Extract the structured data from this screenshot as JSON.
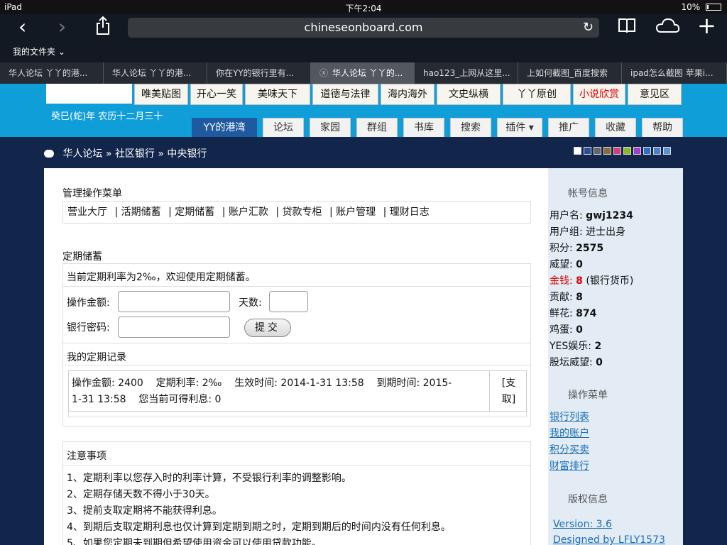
{
  "status_bar": {
    "device": "iPad",
    "time": "下午2:04",
    "battery": "10%"
  },
  "browser": {
    "url": "chineseonboard.com",
    "bookmark_folder": "我的文件夹",
    "tabs": [
      {
        "label": "华人论坛 丫丫的港..."
      },
      {
        "label": "华人论坛 丫丫的港..."
      },
      {
        "label": "你在YY的银行里有..."
      },
      {
        "label": "华人论坛 丫丫的..."
      },
      {
        "label": "hao123_上网从这里..."
      },
      {
        "label": "上如何截图_百度搜索"
      },
      {
        "label": "ipad怎么截图 苹果i..."
      }
    ]
  },
  "header": {
    "date": "癸巳(蛇)年 农历十二月三十",
    "categories": [
      {
        "label": "唯美贴图"
      },
      {
        "label": "开心一笑"
      },
      {
        "label": "美味天下"
      },
      {
        "label": "道德与法律"
      },
      {
        "label": "海内海外"
      },
      {
        "label": "文史纵横"
      },
      {
        "label": "丫丫原创"
      },
      {
        "label": "小说欣赏"
      },
      {
        "label": "意见区"
      }
    ],
    "nav": [
      {
        "label": "YY的港湾"
      },
      {
        "label": "论坛"
      },
      {
        "label": "家园"
      },
      {
        "label": "群组"
      },
      {
        "label": "书库"
      },
      {
        "label": "搜索"
      },
      {
        "label": "插件 ▾"
      },
      {
        "label": "推广"
      },
      {
        "label": "收藏"
      },
      {
        "label": "帮助"
      }
    ]
  },
  "breadcrumb": {
    "home": "华人论坛",
    "sep": "»",
    "level1": "社区银行",
    "level2": "中央银行"
  },
  "theme_swatches": [
    "#ffffff",
    "#2a4f94",
    "#666666",
    "#8a6b3a",
    "#d04080",
    "#8ab820",
    "#a040c0",
    "#3070c0",
    "#4a80c8",
    "#5a90d0"
  ],
  "main": {
    "menu_title": "管理操作菜单",
    "menu_items": [
      {
        "label": "营业大厅"
      },
      {
        "label": "| 活期储蓄"
      },
      {
        "label": "| 定期储蓄"
      },
      {
        "label": "| 账户汇款"
      },
      {
        "label": "| 贷款专柜"
      },
      {
        "label": "| 账户管理"
      },
      {
        "label": "| 理财日志"
      }
    ],
    "fixed_title": "定期储蓄",
    "rate_notice": "当前定期利率为2‰，欢迎使用定期储蓄。",
    "amount_label": "操作金额:",
    "days_label": "天数:",
    "password_label": "银行密码:",
    "submit_label": "提交",
    "records_title": "我的定期记录",
    "record_line1": "操作金额: 2400    定期利率: 2‰    生效时间: 2014-1-31 13:58    到期时间: 2015-",
    "record_line2": "1-31 13:58    您当前可得利息: 0",
    "record_action_1": "[支",
    "record_action_2": "取]",
    "notes_title": "注意事项",
    "notes": [
      "1、定期利率以您存入时的利率计算，不受银行利率的调整影响。",
      "2、定期存储天数不得小于30天。",
      "3、提前支取定期将不能获得利息。",
      "4、到期后支取定期利息也仅计算到定期到期之时，定期到期后的时间内没有任何利息。",
      "5、如果您定期未到期但希望使用资金可以使用贷款功能。"
    ]
  },
  "sidebar": {
    "account_title": "帐号信息",
    "username_label": "用户名: ",
    "username": "gwj1234",
    "group_label": "用户组: ",
    "group": "进士出身",
    "points_label": "积分: ",
    "points": "2575",
    "prestige_label": "威望: ",
    "prestige": "0",
    "money_label": "金钱: ",
    "money": "8",
    "money_unit": " (银行货币)",
    "contrib_label": "贡献: ",
    "contrib": "8",
    "flowers_label": "鲜花: ",
    "flowers": "874",
    "eggs_label": "鸡蛋: ",
    "eggs": "0",
    "yes_label": "YES娱乐: ",
    "yes": "2",
    "stock_label": "股坛威望: ",
    "stock": "0",
    "ops_title": "操作菜单",
    "links": [
      {
        "label": "银行列表"
      },
      {
        "label": "我的账户"
      },
      {
        "label": "积分买卖"
      },
      {
        "label": "财富排行"
      }
    ],
    "copyright_title": "版权信息",
    "version": "Version: 3.6",
    "designed_by": "Designed by LFLY1573"
  }
}
